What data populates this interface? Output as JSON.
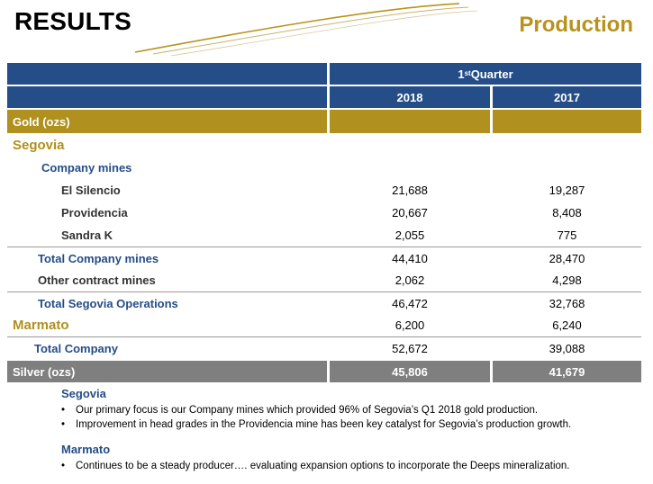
{
  "header": {
    "title": "RESULTS",
    "section": "Production"
  },
  "table": {
    "period_label": "1",
    "period_sup": "st",
    "period_suffix": " Quarter",
    "col_2018": "2018",
    "col_2017": "2017",
    "gold_label": "Gold (ozs)",
    "rows": [
      {
        "label": "Segovia",
        "v2018": "",
        "v2017": ""
      },
      {
        "label": "Company mines",
        "v2018": "",
        "v2017": ""
      },
      {
        "label": "El Silencio",
        "v2018": "21,688",
        "v2017": "19,287"
      },
      {
        "label": "Providencia",
        "v2018": "20,667",
        "v2017": "8,408"
      },
      {
        "label": "Sandra K",
        "v2018": "2,055",
        "v2017": "775"
      },
      {
        "label": "Total Company mines",
        "v2018": "44,410",
        "v2017": "28,470"
      },
      {
        "label": "Other contract mines",
        "v2018": "2,062",
        "v2017": "4,298"
      },
      {
        "label": "Total Segovia Operations",
        "v2018": "46,472",
        "v2017": "32,768"
      },
      {
        "label": "Marmato",
        "v2018": "6,200",
        "v2017": "6,240"
      },
      {
        "label": "Total Company",
        "v2018": "52,672",
        "v2017": "39,088"
      }
    ],
    "silver": {
      "label": "Silver (ozs)",
      "v2018": "45,806",
      "v2017": "41,679"
    }
  },
  "notes": {
    "segovia_head": "Segovia",
    "segovia_bullets": [
      "Our primary focus is our Company mines which provided 96% of Segovia’s Q1 2018 gold production.",
      "Improvement in head grades in the Providencia mine has been key catalyst for Segovia’s production growth."
    ],
    "marmato_head": "Marmato",
    "marmato_bullets": [
      "Continues to be a steady producer…. evaluating expansion options to incorporate the Deeps mineralization."
    ],
    "bullet_glyph": "•"
  },
  "colors": {
    "navy": "#254d87",
    "gold": "#b0901e",
    "gray": "#7f7f7f"
  }
}
